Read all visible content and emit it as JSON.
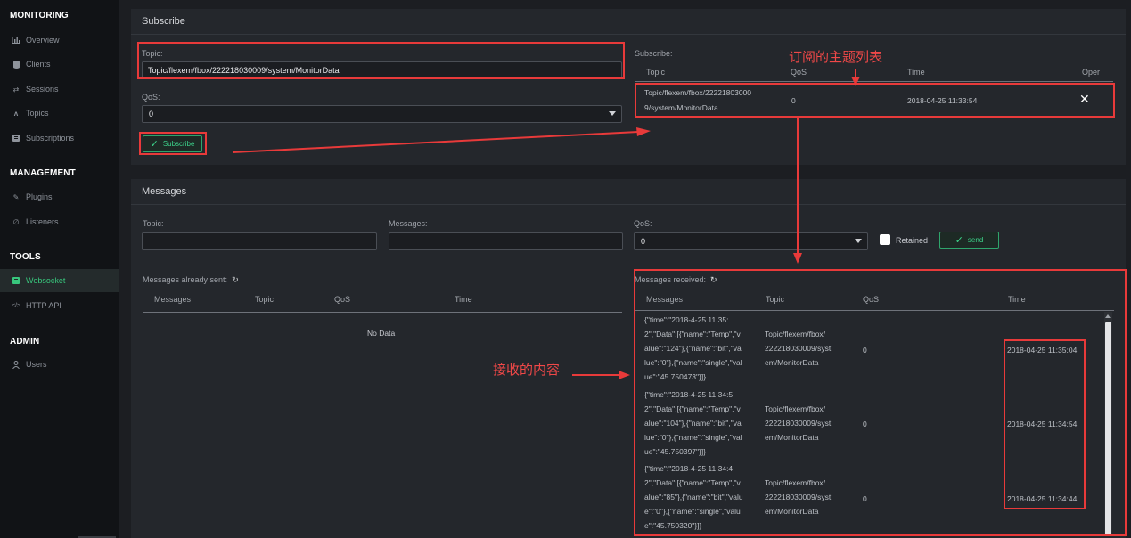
{
  "sidebar": {
    "sections": [
      {
        "title": "MONITORING",
        "items": [
          {
            "label": "Overview",
            "icon": "bar-chart-icon"
          },
          {
            "label": "Clients",
            "icon": "database-icon"
          },
          {
            "label": "Sessions",
            "icon": "swap-arrows-icon"
          },
          {
            "label": "Topics",
            "icon": "topics-icon"
          },
          {
            "label": "Subscriptions",
            "icon": "subscriptions-icon"
          }
        ]
      },
      {
        "title": "MANAGEMENT",
        "items": [
          {
            "label": "Plugins",
            "icon": "plug-icon"
          },
          {
            "label": "Listeners",
            "icon": "listeners-icon"
          }
        ]
      },
      {
        "title": "TOOLS",
        "items": [
          {
            "label": "Websocket",
            "icon": "websocket-icon",
            "active": true
          },
          {
            "label": "HTTP API",
            "icon": "code-icon"
          }
        ]
      },
      {
        "title": "ADMIN",
        "items": [
          {
            "label": "Users",
            "icon": "user-icon"
          }
        ]
      }
    ]
  },
  "subscribe": {
    "title": "Subscribe",
    "topic_label": "Topic:",
    "topic_value": "Topic/flexem/fbox/222218030009/system/MonitorData",
    "qos_label": "QoS:",
    "qos_value": "0",
    "button_label": "Subscribe",
    "list_label": "Subscribe:",
    "columns": [
      "Topic",
      "QoS",
      "Time",
      "Oper"
    ],
    "rows": [
      {
        "topic_lines": [
          "Topic/flexem/fbox/22221803000",
          "9/system/MonitorData"
        ],
        "qos": "0",
        "time": "2018-04-25 11:33:54",
        "oper": "✕"
      }
    ]
  },
  "messages": {
    "title": "Messages",
    "topic_label": "Topic:",
    "messages_label": "Messages:",
    "qos_label": "QoS:",
    "qos_value": "0",
    "retained_label": "Retained",
    "send_label": "send",
    "sent_label": "Messages already sent:",
    "sent_columns": [
      "Messages",
      "Topic",
      "QoS",
      "Time"
    ],
    "no_data": "No Data",
    "received_label": "Messages received:",
    "received_columns": [
      "Messages",
      "Topic",
      "QoS",
      "Time"
    ],
    "received_rows": [
      {
        "msg_lines": [
          "{\"time\":\"2018-4-25 11:35:",
          "2\",\"Data\":[{\"name\":\"Temp\",\"v",
          "alue\":\"124\"},{\"name\":\"bit\",\"va",
          "lue\":\"0\"},{\"name\":\"single\",\"val",
          "ue\":\"45.750473\"}]}"
        ],
        "topic_lines": [
          "Topic/flexem/fbox/",
          "222218030009/syst",
          "em/MonitorData"
        ],
        "qos": "0",
        "time": "2018-04-25 11:35:04"
      },
      {
        "msg_lines": [
          "{\"time\":\"2018-4-25 11:34:5",
          "2\",\"Data\":[{\"name\":\"Temp\",\"v",
          "alue\":\"104\"},{\"name\":\"bit\",\"va",
          "lue\":\"0\"},{\"name\":\"single\",\"val",
          "ue\":\"45.750397\"}]}"
        ],
        "topic_lines": [
          "Topic/flexem/fbox/",
          "222218030009/syst",
          "em/MonitorData"
        ],
        "qos": "0",
        "time": "2018-04-25 11:34:54"
      },
      {
        "msg_lines": [
          "{\"time\":\"2018-4-25 11:34:4",
          "2\",\"Data\":[{\"name\":\"Temp\",\"v",
          "alue\":\"85\"},{\"name\":\"bit\",\"valu",
          "e\":\"0\"},{\"name\":\"single\",\"valu",
          "e\":\"45.750320\"}]}"
        ],
        "topic_lines": [
          "Topic/flexem/fbox/",
          "222218030009/syst",
          "em/MonitorData"
        ],
        "qos": "0",
        "time": "2018-04-25 11:34:44"
      }
    ]
  },
  "annotations": {
    "subscribed_list": "订阅的主题列表",
    "received_content": "接收的内容"
  },
  "colors": {
    "accent": "#38c77d",
    "annotation_red": "#e83a3a",
    "panel": "#24272c",
    "sidebar": "#111316"
  }
}
